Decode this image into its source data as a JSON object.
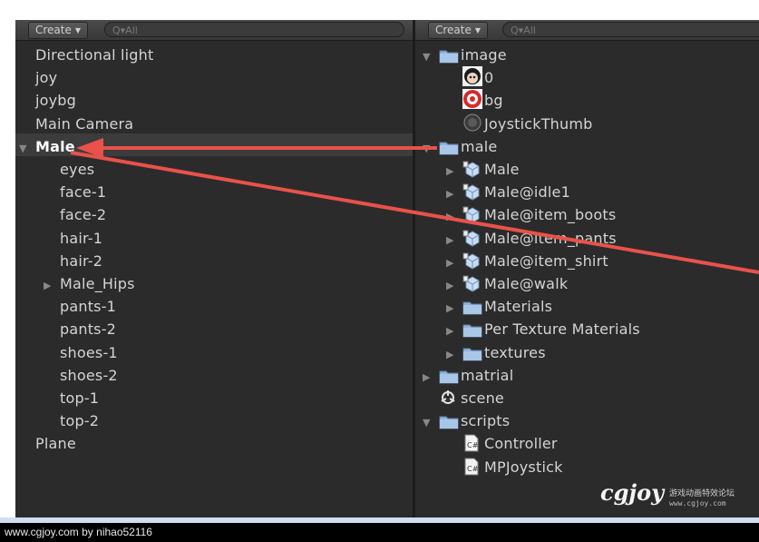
{
  "hierarchy": {
    "create_label": "Create",
    "search_placeholder": "Q▾All",
    "items": [
      {
        "label": "Directional light",
        "indent": 0
      },
      {
        "label": "joy",
        "indent": 0
      },
      {
        "label": "joybg",
        "indent": 0
      },
      {
        "label": "Main Camera",
        "indent": 0
      },
      {
        "label": "Male",
        "indent": 0,
        "expanded": true,
        "selected": true
      },
      {
        "label": "eyes",
        "indent": 1
      },
      {
        "label": "face-1",
        "indent": 1
      },
      {
        "label": "face-2",
        "indent": 1
      },
      {
        "label": "hair-1",
        "indent": 1
      },
      {
        "label": "hair-2",
        "indent": 1
      },
      {
        "label": "Male_Hips",
        "indent": 1,
        "collapsed": true
      },
      {
        "label": "pants-1",
        "indent": 1
      },
      {
        "label": "pants-2",
        "indent": 1
      },
      {
        "label": "shoes-1",
        "indent": 1
      },
      {
        "label": "shoes-2",
        "indent": 1
      },
      {
        "label": "top-1",
        "indent": 1
      },
      {
        "label": "top-2",
        "indent": 1
      },
      {
        "label": "Plane",
        "indent": 0
      }
    ]
  },
  "project": {
    "create_label": "Create",
    "search_placeholder": "Q▾All",
    "items": [
      {
        "label": "image",
        "icon": "folder-icon",
        "indent": 0,
        "expanded": true
      },
      {
        "label": "0",
        "icon": "face-texture-icon",
        "indent": 1
      },
      {
        "label": "bg",
        "icon": "target-texture-icon",
        "indent": 1
      },
      {
        "label": "JoystickThumb",
        "icon": "thumb-texture-icon",
        "indent": 1
      },
      {
        "label": "male",
        "icon": "folder-icon",
        "indent": 0,
        "expanded": true
      },
      {
        "label": "Male",
        "icon": "model-icon",
        "indent": 1,
        "collapsed": true
      },
      {
        "label": "Male@idle1",
        "icon": "model-icon",
        "indent": 1,
        "collapsed": true
      },
      {
        "label": "Male@item_boots",
        "icon": "model-icon",
        "indent": 1,
        "collapsed": true
      },
      {
        "label": "Male@item_pants",
        "icon": "model-icon",
        "indent": 1,
        "collapsed": true
      },
      {
        "label": "Male@item_shirt",
        "icon": "model-icon",
        "indent": 1,
        "collapsed": true
      },
      {
        "label": "Male@walk",
        "icon": "model-icon",
        "indent": 1,
        "collapsed": true
      },
      {
        "label": "Materials",
        "icon": "folder-icon",
        "indent": 1,
        "collapsed": true
      },
      {
        "label": "Per Texture Materials",
        "icon": "folder-icon",
        "indent": 1,
        "collapsed": true
      },
      {
        "label": "textures",
        "icon": "folder-icon",
        "indent": 1,
        "collapsed": true
      },
      {
        "label": "matrial",
        "icon": "folder-icon",
        "indent": 0,
        "collapsed": true
      },
      {
        "label": "scene",
        "icon": "unity-scene-icon",
        "indent": 0
      },
      {
        "label": "scripts",
        "icon": "folder-icon",
        "indent": 0,
        "expanded": true
      },
      {
        "label": "Controller",
        "icon": "csharp-script-icon",
        "indent": 1
      },
      {
        "label": "MPJoystick",
        "icon": "csharp-script-icon",
        "indent": 1
      }
    ]
  },
  "watermark": {
    "logo": "cgjoy",
    "tagline": "游戏动画特效论坛",
    "url": "www.cgjoy.com"
  },
  "footer": {
    "text": "www.cgjoy.com by nihao52116"
  },
  "colors": {
    "panel_bg": "#2b2b2b",
    "arrow": "#e8524a",
    "folder": "#8fb4dc"
  }
}
